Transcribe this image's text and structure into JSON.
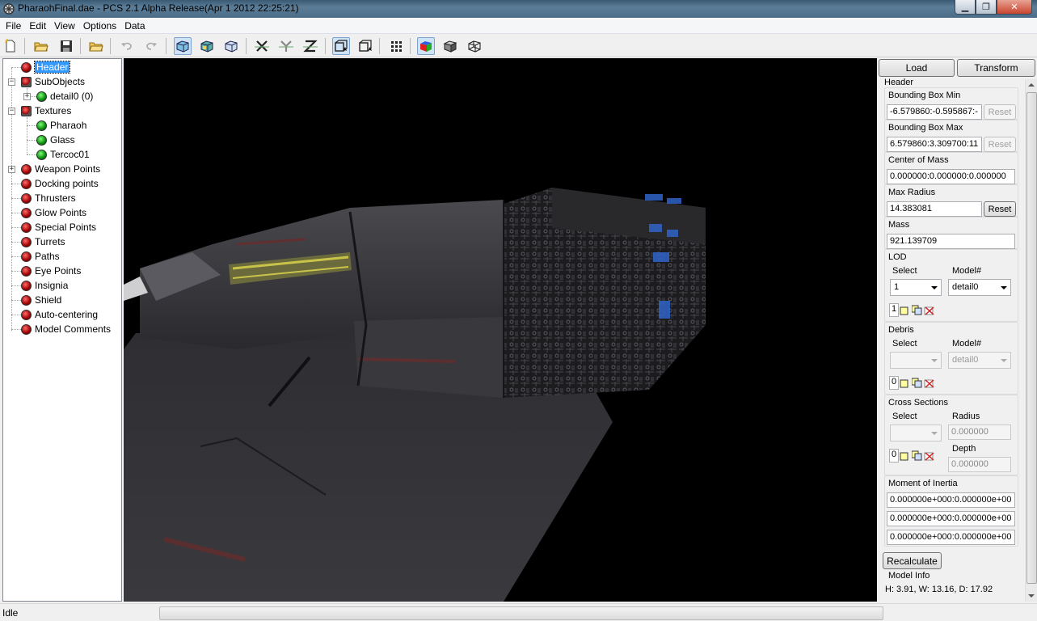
{
  "window": {
    "title": "PharaohFinal.dae - PCS 2.1 Alpha Release(Apr  1 2012 22:25:21)"
  },
  "menu": [
    "File",
    "Edit",
    "View",
    "Options",
    "Data"
  ],
  "toolbar": {
    "icons": [
      "new-icon",
      "open-icon",
      "save-icon",
      "open-folder-icon",
      "undo-icon",
      "redo-icon",
      "view-solid-icon",
      "view-textured-icon",
      "view-wire-icon",
      "x-axis-icon",
      "y-axis-icon",
      "z-axis-icon",
      "box-front-icon",
      "box-back-icon",
      "grid-icon",
      "color-cube-icon",
      "shaded-cube-icon",
      "wire-cube-icon"
    ]
  },
  "tree": {
    "items": [
      {
        "label": "Header",
        "icon": "red",
        "level": 1,
        "selected": true
      },
      {
        "label": "SubObjects",
        "icon": "cube",
        "level": 1,
        "expander": "-"
      },
      {
        "label": "detail0 (0)",
        "icon": "green",
        "level": 2,
        "expander": "+"
      },
      {
        "label": "Textures",
        "icon": "cube",
        "level": 1,
        "expander": "-"
      },
      {
        "label": "Pharaoh",
        "icon": "green",
        "level": 2
      },
      {
        "label": "Glass",
        "icon": "green",
        "level": 2
      },
      {
        "label": "Tercoc01",
        "icon": "green",
        "level": 2
      },
      {
        "label": "Weapon Points",
        "icon": "red",
        "level": 1,
        "expander": "+"
      },
      {
        "label": "Docking points",
        "icon": "red",
        "level": 1
      },
      {
        "label": "Thrusters",
        "icon": "red",
        "level": 1
      },
      {
        "label": "Glow Points",
        "icon": "red",
        "level": 1
      },
      {
        "label": "Special Points",
        "icon": "red",
        "level": 1
      },
      {
        "label": "Turrets",
        "icon": "red",
        "level": 1
      },
      {
        "label": "Paths",
        "icon": "red",
        "level": 1
      },
      {
        "label": "Eye Points",
        "icon": "red",
        "level": 1
      },
      {
        "label": "Insignia",
        "icon": "red",
        "level": 1
      },
      {
        "label": "Shield",
        "icon": "red",
        "level": 1
      },
      {
        "label": "Auto-centering",
        "icon": "red",
        "level": 1
      },
      {
        "label": "Model Comments",
        "icon": "red",
        "level": 1
      }
    ]
  },
  "panel": {
    "load_label": "Load",
    "transform_label": "Transform",
    "section_title": "Header",
    "bbox_min": {
      "label": "Bounding Box Min",
      "value": "-6.579860:-0.595867:-",
      "reset": "Reset"
    },
    "bbox_max": {
      "label": "Bounding Box Max",
      "value": "6.579860:3.309700:11",
      "reset": "Reset"
    },
    "center_of_mass": {
      "label": "Center of Mass",
      "value": "0.000000:0.000000:0.000000"
    },
    "max_radius": {
      "label": "Max Radius",
      "value": "14.383081",
      "reset": "Reset"
    },
    "mass": {
      "label": "Mass",
      "value": "921.139709"
    },
    "lod": {
      "label": "LOD",
      "select_label": "Select",
      "model_label": "Model#",
      "select_value": "1",
      "model_value": "detail0",
      "count": "1"
    },
    "debris": {
      "label": "Debris",
      "select_label": "Select",
      "model_label": "Model#",
      "select_value": "",
      "model_value": "detail0",
      "count": "0"
    },
    "cross_sections": {
      "label": "Cross Sections",
      "select_label": "Select",
      "radius_label": "Radius",
      "radius_value": "0.000000",
      "depth_label": "Depth",
      "depth_value": "0.000000",
      "count": "0"
    },
    "moi": {
      "label": "Moment of Inertia",
      "rows": [
        "0.000000e+000:0.000000e+00",
        "0.000000e+000:0.000000e+00",
        "0.000000e+000:0.000000e+00"
      ]
    },
    "recalculate_label": "Recalculate",
    "model_info": {
      "label": "Model Info",
      "value": "H: 3.91, W: 13.16, D: 17.92"
    }
  },
  "status": {
    "text": "Idle"
  }
}
